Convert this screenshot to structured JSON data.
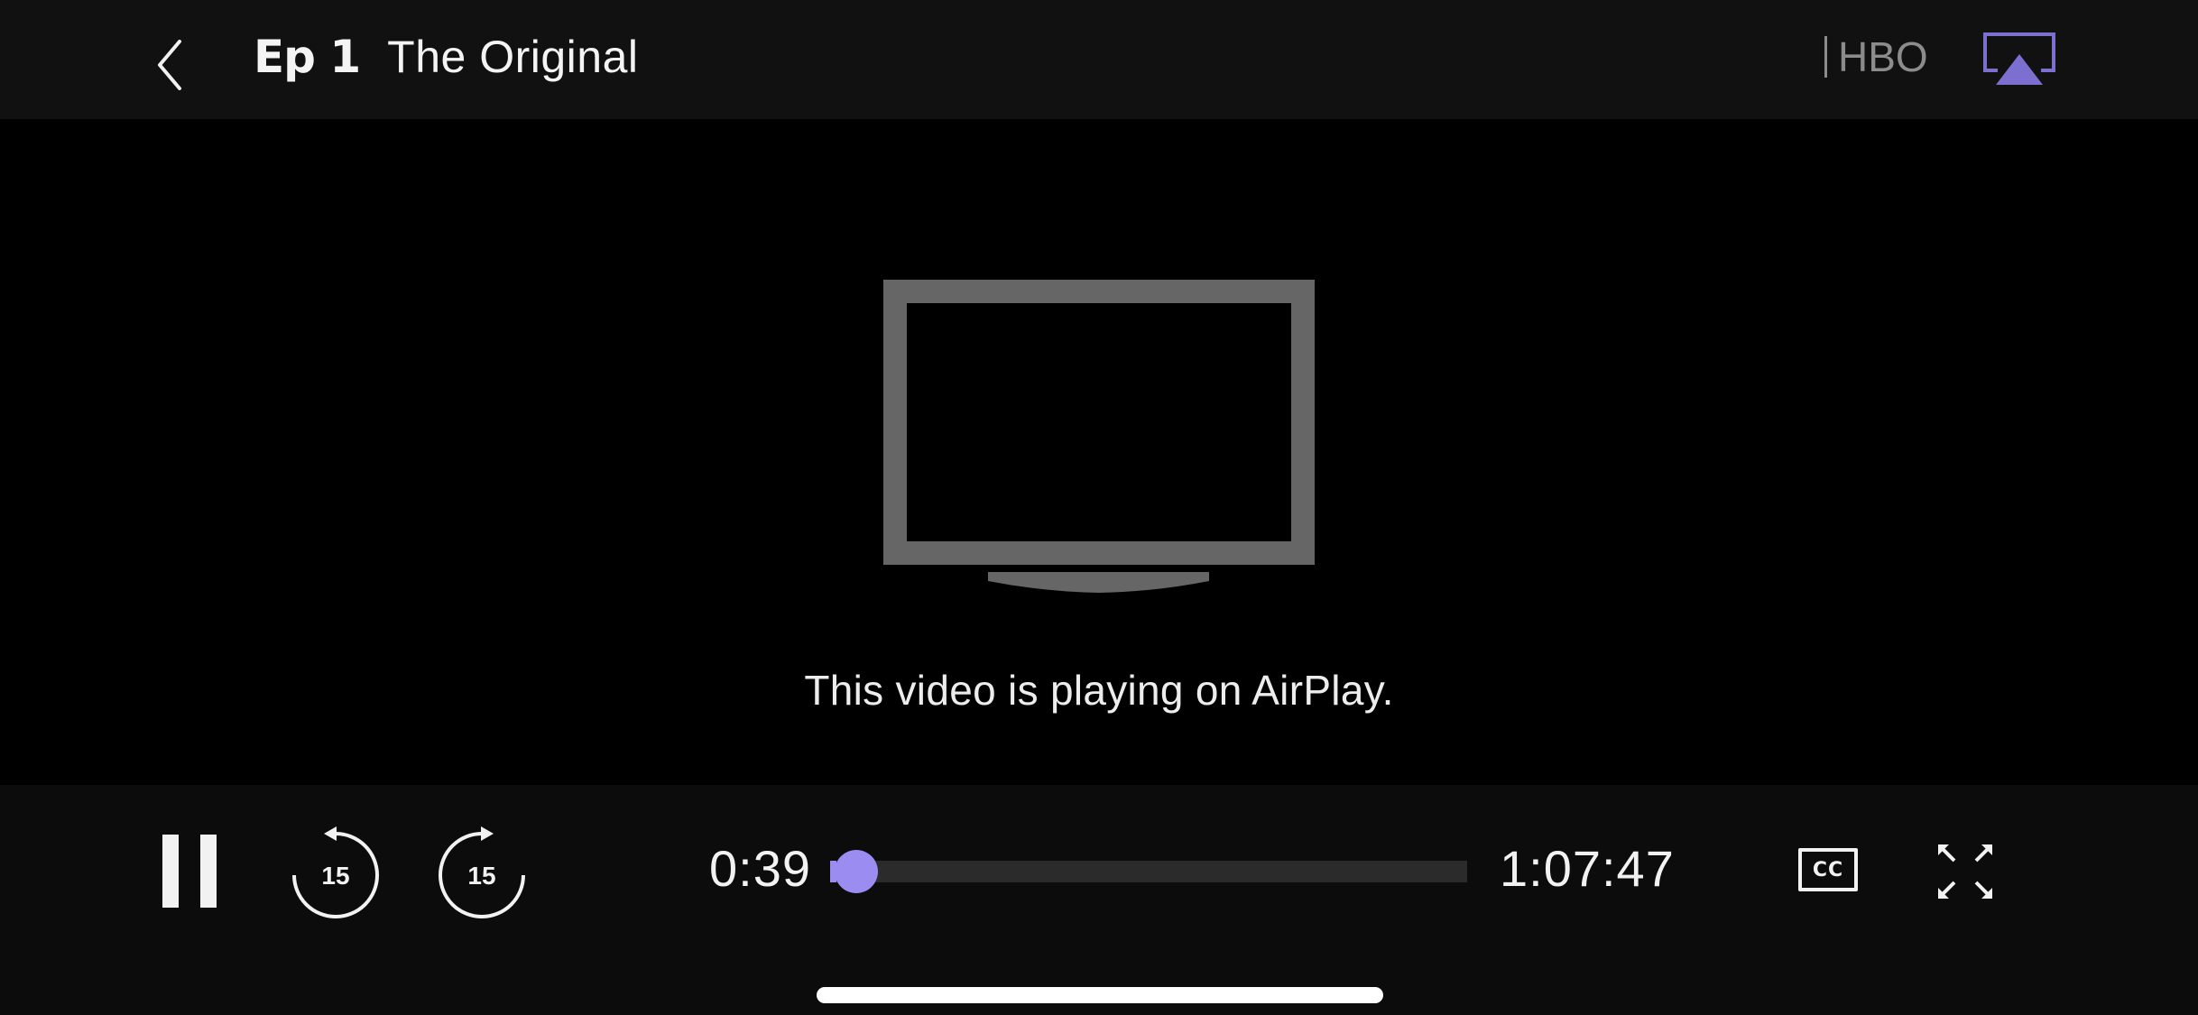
{
  "header": {
    "episode_label": "Ep 1",
    "episode_title": "The Original",
    "network": "HBO",
    "back_icon": "chevron-left-icon",
    "airplay_icon": "airplay-icon",
    "airplay_active_color": "#7b6fd0"
  },
  "main": {
    "status_icon": "tv-icon",
    "message": "This video is playing on AirPlay."
  },
  "controls": {
    "pause_icon": "pause-icon",
    "rewind": {
      "icon": "rewind-15-icon",
      "seconds": "15"
    },
    "forward": {
      "icon": "forward-15-icon",
      "seconds": "15"
    },
    "current_time": "0:39",
    "total_time": "1:07:47",
    "progress_fraction": 0.0096,
    "accent_color": "#9b8cf2",
    "captions_label": "CC",
    "fullscreen_icon": "fullscreen-icon"
  }
}
